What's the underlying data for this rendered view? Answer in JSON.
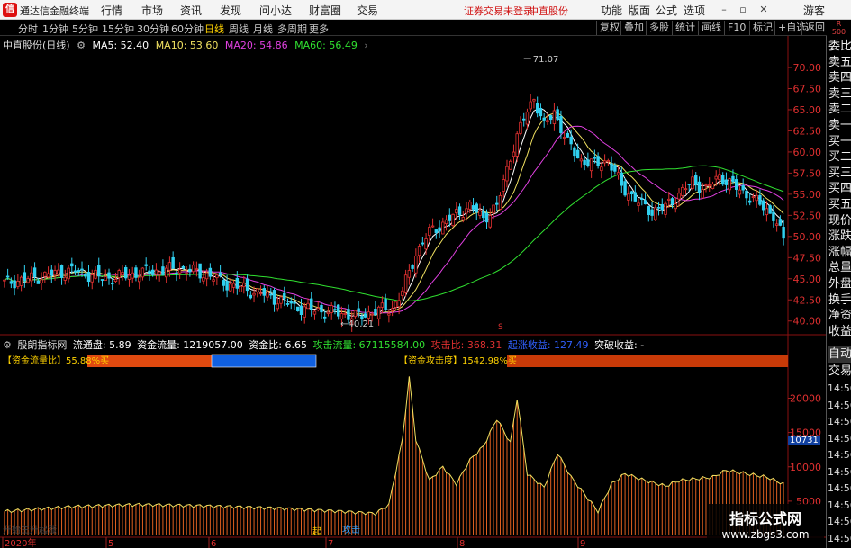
{
  "titlebar": {
    "logo": "信",
    "app_name": "通达信金融终端",
    "menus": [
      "行情",
      "市场",
      "资讯",
      "发现",
      "问小达",
      "财富圈",
      "交易"
    ],
    "status": "证券交易未登录",
    "stock": "中直股份",
    "tools": [
      "功能",
      "版面",
      "公式",
      "选项"
    ],
    "guest": "游客"
  },
  "periodbar": {
    "periods": [
      "分时",
      "1分钟",
      "5分钟",
      "15分钟",
      "30分钟",
      "60分钟",
      "日线",
      "周线",
      "月线",
      "多周期",
      "更多"
    ],
    "active": "日线",
    "right_tools": [
      "复权",
      "叠加",
      "多股",
      "统计",
      "画线",
      "F10",
      "标记",
      "+自选",
      "返回"
    ],
    "badge_top": "R",
    "badge_bottom": "500"
  },
  "chart": {
    "title": "中直股份(日线)",
    "ma5": "MA5: 52.40",
    "ma10": "MA10: 53.60",
    "ma20": "MA20: 54.86",
    "ma60": "MA60: 56.49",
    "high_label": "71.07",
    "low_label": "40.21",
    "price_ticks": [
      "70.00",
      "67.50",
      "65.00",
      "62.50",
      "60.00",
      "57.50",
      "55.00",
      "52.50",
      "50.00",
      "47.50",
      "45.00",
      "42.50",
      "40.00"
    ],
    "date_labels": [
      "2020年",
      "5",
      "6",
      "7",
      "8",
      "9"
    ]
  },
  "indicator": {
    "name": "殷朗指标网",
    "liutong": "流通盘: 5.89",
    "zjll": "资金流量: 1219057.00",
    "zjb": "资金比: 6.65",
    "gjll": "攻击流量: 67115584.00",
    "gjb": "攻击比: 368.31",
    "qzsy": "起涨收益: 127.49",
    "tpsy": "突破收益: -",
    "bar1_label": "【资金流量比】55.88%买",
    "bar2_label": "【资金攻击度】1542.98%买",
    "vol_ticks": [
      "20000",
      "15000",
      "10000",
      "5000"
    ],
    "current_value": "10731",
    "attack_tag": "攻击",
    "start_tag": "起",
    "bottom_note": "开始主升起涨"
  },
  "sidepanel": {
    "items": [
      "委比",
      "卖五",
      "卖四",
      "卖三",
      "卖二",
      "卖一",
      "买一",
      "买二",
      "买三",
      "买四",
      "买五",
      "现价",
      "涨跌",
      "涨幅",
      "总量",
      "外盘",
      "换手",
      "净资",
      "收益"
    ],
    "auto_label": "自动",
    "trade_label": "交易",
    "times": [
      "14:56",
      "14:56",
      "14:56",
      "14:56",
      "14:56",
      "14:56",
      "14:56",
      "14:56",
      "14:56",
      "14:56"
    ]
  },
  "watermark": {
    "line1": "指标公式网",
    "line2": "www.zbgs3.com"
  },
  "colors": {
    "up": "#e03030",
    "down": "#30d0f0",
    "ma5": "#ffffff",
    "ma10": "#f0e060",
    "ma20": "#e040e0",
    "ma60": "#30e030"
  }
}
